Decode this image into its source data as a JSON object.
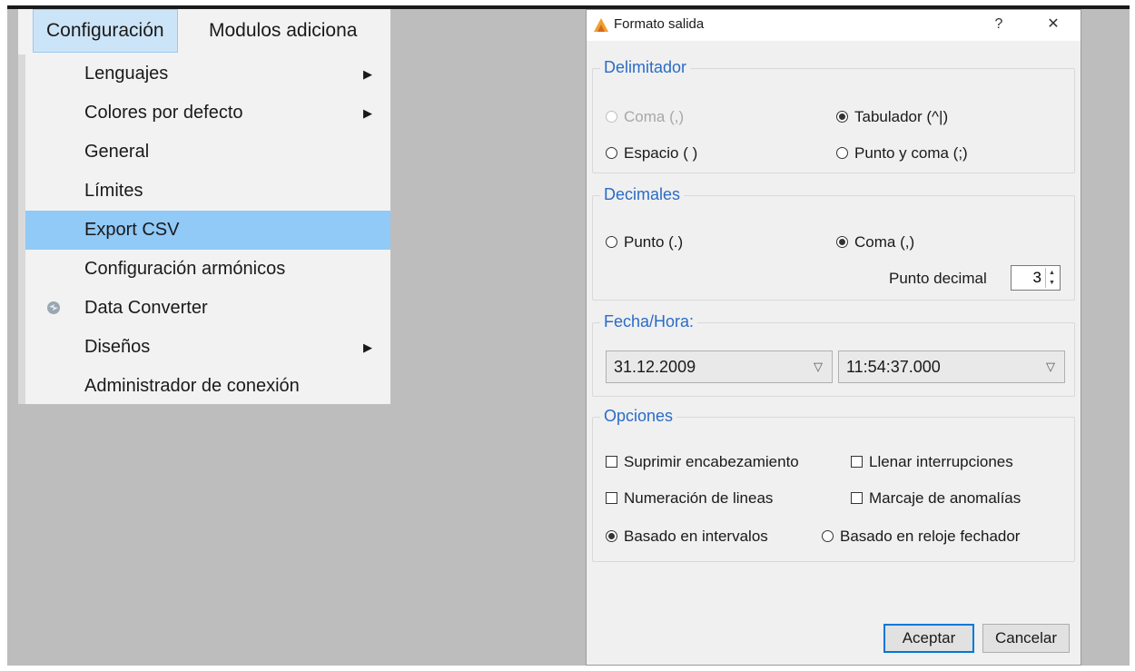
{
  "menubar": {
    "items": [
      {
        "label": "Configuración"
      },
      {
        "label": "Modulos adiciona"
      }
    ]
  },
  "menu": {
    "items": [
      {
        "label": "Lenguajes",
        "submenu": true
      },
      {
        "label": "Colores por defecto",
        "submenu": true
      },
      {
        "label": "General"
      },
      {
        "label": "Límites"
      },
      {
        "label": "Export CSV",
        "highlighted": true
      },
      {
        "label": "Configuración armónicos"
      },
      {
        "label": "Data Converter",
        "icon": "data-converter-icon"
      },
      {
        "label": "Diseños",
        "submenu": true
      },
      {
        "label": "Administrador de conexión"
      }
    ]
  },
  "dialog": {
    "title": "Formato salida",
    "help_label": "?",
    "close_label": "✕",
    "delimiter": {
      "title": "Delimitador",
      "options": [
        "Coma (,)",
        "Tabulador (^|)",
        "Espacio ( )",
        "Punto y coma (;)"
      ],
      "selected": "Tabulador (^|)",
      "disabled": [
        "Coma (,)"
      ]
    },
    "decimals": {
      "title": "Decimales",
      "options": [
        "Punto (.)",
        "Coma (,)"
      ],
      "selected": "Coma (,)",
      "decimal_point_label": "Punto decimal",
      "decimal_point_value": "3"
    },
    "datetime": {
      "title": "Fecha/Hora:",
      "date_value": "31.12.2009",
      "time_value": "11:54:37.000"
    },
    "options": {
      "title": "Opciones",
      "checkboxes": [
        "Suprimir encabezamiento",
        "Llenar interrupciones",
        "Numeración de lineas",
        "Marcaje de anomalías"
      ],
      "radios": [
        "Basado en intervalos",
        "Basado en reloje fechador"
      ],
      "selected_radio": "Basado en intervalos"
    },
    "ok_label": "Aceptar",
    "cancel_label": "Cancelar"
  },
  "colors": {
    "menu_highlight": "#91c9f7",
    "group_title": "#2a6cc6",
    "default_button_border": "#0078d7"
  }
}
